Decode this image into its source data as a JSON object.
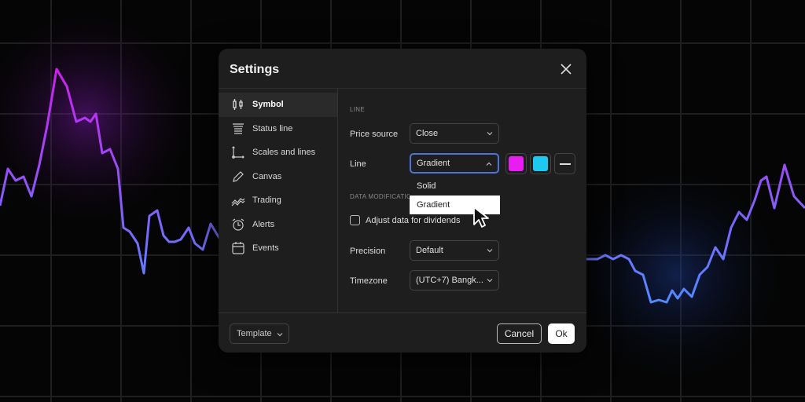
{
  "dialog": {
    "title": "Settings",
    "sidebar": [
      {
        "label": "Symbol",
        "icon": "candlestick-icon",
        "active": true
      },
      {
        "label": "Status line",
        "icon": "status-line-icon"
      },
      {
        "label": "Scales and lines",
        "icon": "axes-icon"
      },
      {
        "label": "Canvas",
        "icon": "pencil-icon"
      },
      {
        "label": "Trading",
        "icon": "trading-icon"
      },
      {
        "label": "Alerts",
        "icon": "alarm-clock-icon"
      },
      {
        "label": "Events",
        "icon": "calendar-icon"
      }
    ],
    "line_section": "LINE",
    "price_source": {
      "label": "Price source",
      "value": "Close"
    },
    "line": {
      "label": "Line",
      "value": "Gradient",
      "color1": "#e61ef0",
      "color2": "#1ec8f0"
    },
    "dropdown_options": [
      "Solid",
      "Gradient"
    ],
    "data_mod_section": "DATA MODIFICATION",
    "adjust_dividends": {
      "label": "Adjust data for dividends",
      "checked": false
    },
    "precision": {
      "label": "Precision",
      "value": "Default"
    },
    "timezone": {
      "label": "Timezone",
      "value": "(UTC+7) Bangk..."
    },
    "template_label": "Template",
    "cancel_label": "Cancel",
    "ok_label": "Ok"
  },
  "colors": {
    "accent": "#4d74d8",
    "line_top": "#d21cf0",
    "line_bottom": "#5a78ff"
  }
}
